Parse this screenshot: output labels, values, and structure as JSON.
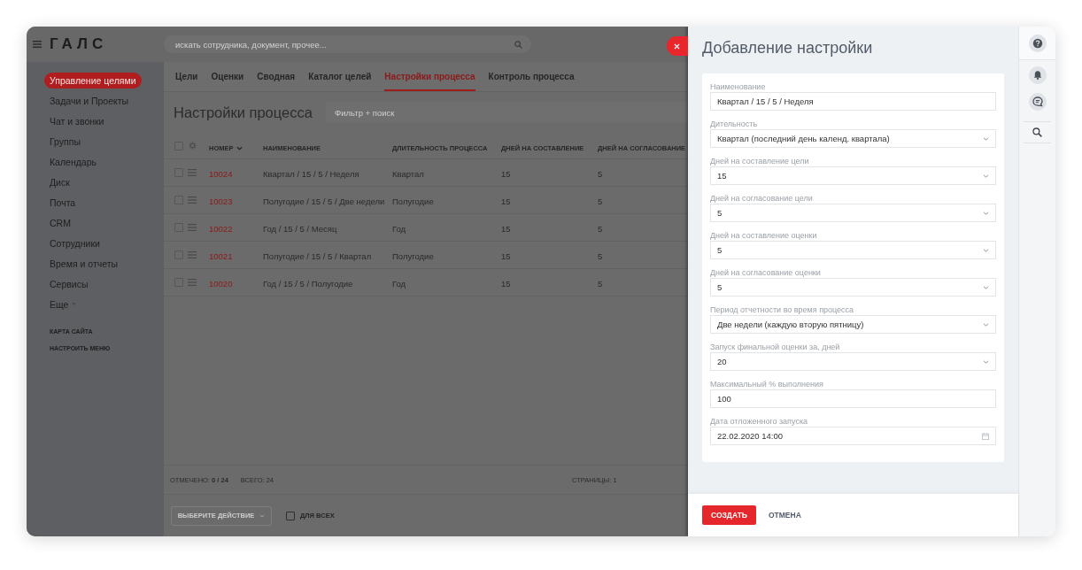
{
  "header": {
    "logo": "ГАЛС",
    "search": {
      "placeholder": "искать сотрудника, документ, прочее..."
    }
  },
  "sidebar": {
    "items": [
      {
        "label": "Управление целями",
        "selected": true,
        "expandable": false
      },
      {
        "label": "Задачи и Проекты",
        "selected": false,
        "expandable": false
      },
      {
        "label": "Чат и звонки",
        "selected": false,
        "expandable": false
      },
      {
        "label": "Группы",
        "selected": false,
        "expandable": false
      },
      {
        "label": "Календарь",
        "selected": false,
        "expandable": false
      },
      {
        "label": "Диск",
        "selected": false,
        "expandable": false
      },
      {
        "label": "Почта",
        "selected": false,
        "expandable": false
      },
      {
        "label": "CRM",
        "selected": false,
        "expandable": false
      },
      {
        "label": "Сотрудники",
        "selected": false,
        "expandable": false
      },
      {
        "label": "Время и отчеты",
        "selected": false,
        "expandable": false
      },
      {
        "label": "Сервисы",
        "selected": false,
        "expandable": false
      },
      {
        "label": "Еще",
        "selected": false,
        "expandable": true
      }
    ],
    "links": [
      "КАРТА САЙТА",
      "НАСТРОИТЬ МЕНЮ"
    ]
  },
  "tabs": [
    {
      "label": "Цели",
      "selected": false
    },
    {
      "label": "Оценки",
      "selected": false
    },
    {
      "label": "Сводная",
      "selected": false
    },
    {
      "label": "Каталог целей",
      "selected": false
    },
    {
      "label": "Настройки процесса",
      "selected": true
    },
    {
      "label": "Контроль процесса",
      "selected": false
    }
  ],
  "content": {
    "title": "Настройки процесса",
    "filter": {
      "placeholder": "Фильтр + поиск"
    }
  },
  "table": {
    "select_all": {
      "checked": false
    },
    "columns": [
      {
        "label": "НОМЕР",
        "sorted": true
      },
      {
        "label": "НАИМЕНОВАНИЕ",
        "sorted": false
      },
      {
        "label": "ДЛИТЕЛЬНОСТЬ ПРОЦЕССА",
        "sorted": false
      },
      {
        "label": "ДНЕЙ НА СОСТАВЛЕНИЕ",
        "sorted": false
      },
      {
        "label": "ДНЕЙ НА СОГЛАСОВАНИЕ",
        "sorted": false
      }
    ],
    "rows": [
      {
        "checked": false,
        "cells": [
          "10024",
          "Квартал / 15 / 5 / Неделя",
          "Квартал",
          "15",
          "5"
        ]
      },
      {
        "checked": false,
        "cells": [
          "10023",
          "Полугодие / 15 / 5 / Две недели",
          "Полугодие",
          "15",
          "5"
        ]
      },
      {
        "checked": false,
        "cells": [
          "10022",
          "Год / 15 / 5 / Месяц",
          "Год",
          "15",
          "5"
        ]
      },
      {
        "checked": false,
        "cells": [
          "10021",
          "Полугодие / 15 / 5 / Квартал",
          "Полугодие",
          "15",
          "5"
        ]
      },
      {
        "checked": false,
        "cells": [
          "10020",
          "Год / 15 / 5 / Полугодие",
          "Год",
          "15",
          "5"
        ]
      }
    ]
  },
  "status_bar": {
    "marked": "ОТМЕЧЕНО: **0 / 24**",
    "total": "ВСЕГО: 24",
    "pages": "СТРАНИЦЫ: 1"
  },
  "actions": {
    "action_select": "ВЫБЕРИТЕ ДЕЙСТВИЕ",
    "for_all": {
      "label": "ДЛЯ ВСЕХ",
      "checked": false
    }
  },
  "panel": {
    "title": "Добавление настройки",
    "fields": [
      {
        "label": "Наименование",
        "kind": "text",
        "value": "Квартал / 15 / 5 / Неделя"
      },
      {
        "label": "Дительность",
        "kind": "select",
        "value": "Квартал (последний день календ. квартала)"
      },
      {
        "label": "Дней на составление цели",
        "kind": "select",
        "value": "15"
      },
      {
        "label": "Дней на согласование цели",
        "kind": "select",
        "value": "5"
      },
      {
        "label": "Дней на составление оценки",
        "kind": "select",
        "value": "5"
      },
      {
        "label": "Дней на согласование оценки",
        "kind": "select",
        "value": "5"
      },
      {
        "label": "Период отчетности во время процесса",
        "kind": "select",
        "value": "Две недели (каждую вторую пятницу)"
      },
      {
        "label": "Запуск финальной оценки за, дней",
        "kind": "select",
        "value": "20"
      },
      {
        "label": "Максимальный % выполнения",
        "kind": "text",
        "value": "100"
      },
      {
        "label": "Дата отложенного запуска",
        "kind": "date",
        "value": "22.02.2020 14:00"
      }
    ],
    "buttons": [
      {
        "label": "СОЗДАТЬ",
        "kind": "primary"
      },
      {
        "label": "ОТМЕНА",
        "kind": "secondary"
      }
    ]
  }
}
